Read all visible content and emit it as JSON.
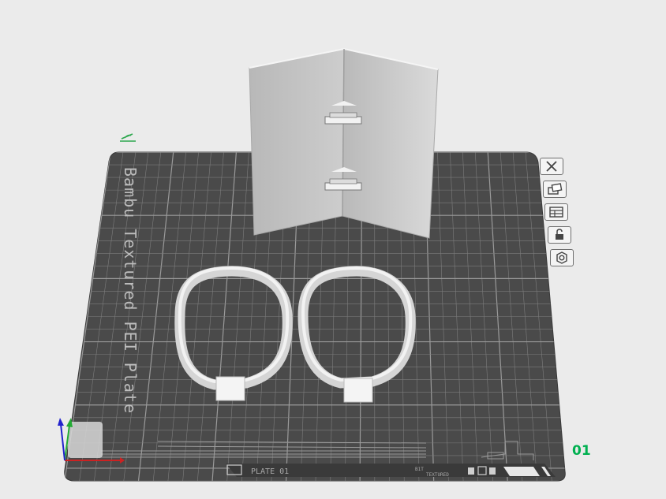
{
  "plate": {
    "name": "Bambu Textured PEI Plate",
    "number": "01",
    "footer_label": "PLATE 01",
    "footer_small_top": "B1T",
    "footer_small_bottom": "TEXTURED"
  },
  "colors": {
    "background": "#ebebeb",
    "plate": "#4a4a4a",
    "grid": "#8a8a8a",
    "model": "#cfcfcf",
    "accent_green": "#00b050"
  },
  "toolbar": {
    "buttons": [
      {
        "name": "remove-plate-button",
        "icon": "close-icon"
      },
      {
        "name": "arrange-plate-button",
        "icon": "arrange-icon"
      },
      {
        "name": "orient-plate-button",
        "icon": "layout-icon"
      },
      {
        "name": "lock-plate-button",
        "icon": "lock-icon"
      },
      {
        "name": "plate-settings-button",
        "icon": "settings-icon"
      }
    ]
  },
  "objects": [
    {
      "name": "folded-stand"
    },
    {
      "name": "oval-ring-left"
    },
    {
      "name": "oval-ring-right"
    }
  ]
}
